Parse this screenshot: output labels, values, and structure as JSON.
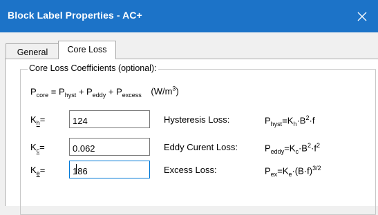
{
  "window": {
    "title": "Block Label Properties - AC+",
    "close_icon": "close-icon"
  },
  "tabs": [
    {
      "label": "General",
      "active": false
    },
    {
      "label": "Core Loss",
      "active": true
    }
  ],
  "group": {
    "label": "Core Loss Coefficients (optional):"
  },
  "formula": {
    "p": "P",
    "core": "core",
    "eq": " = ",
    "hyst": "hyst",
    "plus1": " + ",
    "eddy": "eddy",
    "plus2": " + ",
    "excess": "excess",
    "units": "(W/m",
    "units_exp": "3",
    "units_close": ")"
  },
  "rows": [
    {
      "k_sub": "h",
      "eq_sign": "=",
      "value": "124",
      "label": "Hysteresis Loss:",
      "f_sub": "hyst",
      "f_rest": "=K",
      "f_ksub": "h",
      "f_tail": "·B",
      "f_exp": "2",
      "f_end": "·f"
    },
    {
      "k_sub": "c",
      "eq_sign": "=",
      "value": "0.062",
      "label": "Eddy Curent Loss:",
      "f_sub": "eddy",
      "f_rest": "=K",
      "f_ksub": "c",
      "f_tail": "·B",
      "f_exp": "2",
      "f_end": "·f",
      "f_exp2": "2"
    },
    {
      "k_sub": "e",
      "eq_sign": "=",
      "value": "186",
      "label": "Excess Loss:",
      "f_sub": "ex",
      "f_rest": "=K",
      "f_ksub": "e",
      "f_tail": "·(B·f)",
      "f_exp": "3/2"
    }
  ]
}
